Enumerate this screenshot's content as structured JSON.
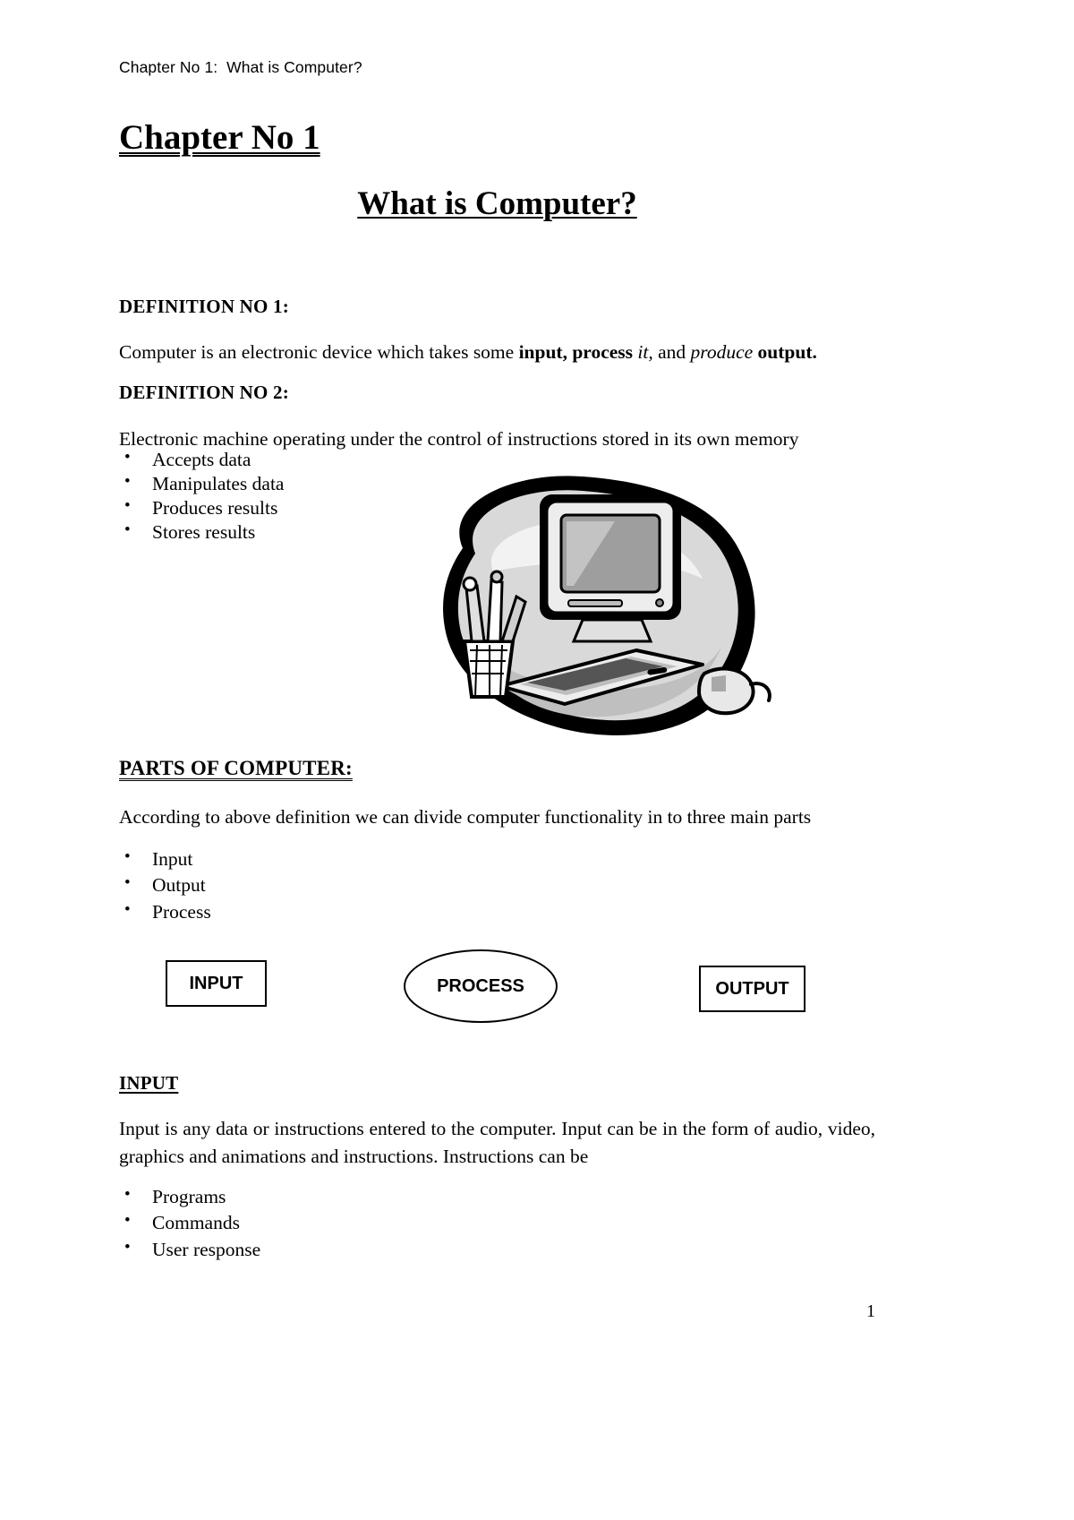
{
  "header": {
    "running_head": "Chapter No 1:  What is Computer?"
  },
  "titles": {
    "chapter": "Chapter No 1",
    "document": "What is Computer?"
  },
  "definition1": {
    "heading": "DEFINITION NO 1:",
    "text_part1": "Computer is an electronic device which takes some ",
    "text_bold1": "input, process",
    "text_italic1": " it,",
    "text_part2": " and ",
    "text_italic2": "produce ",
    "text_bold2": "output."
  },
  "definition2": {
    "heading": "DEFINITION NO 2:",
    "lead": "Electronic machine operating under the control of instructions stored in its own memory",
    "bullets": [
      "Accepts data",
      "Manipulates data",
      "Produces results",
      "Stores results"
    ]
  },
  "clipart": {
    "name": "desktop-computer-illustration",
    "alt": "Illustration of a desktop computer with monitor, keyboard, mouse and pencil cup"
  },
  "parts": {
    "heading": "PARTS OF COMPUTER:",
    "paragraph": "According to above definition we can divide computer functionality in to three main parts",
    "bullets": [
      "Input",
      "Output",
      "Process"
    ]
  },
  "diagram": {
    "input_label": "INPUT",
    "process_label": "PROCESS",
    "output_label": "OUTPUT"
  },
  "input_section": {
    "heading": "INPUT",
    "paragraph": "Input is any data or instructions entered to the computer. Input can be in the form of audio, video, graphics and animations and instructions. Instructions can be",
    "bullets": [
      "Programs",
      "Commands",
      "User response"
    ]
  },
  "footer": {
    "page_number": "1"
  },
  "symbols": {
    "bullet": "•"
  }
}
